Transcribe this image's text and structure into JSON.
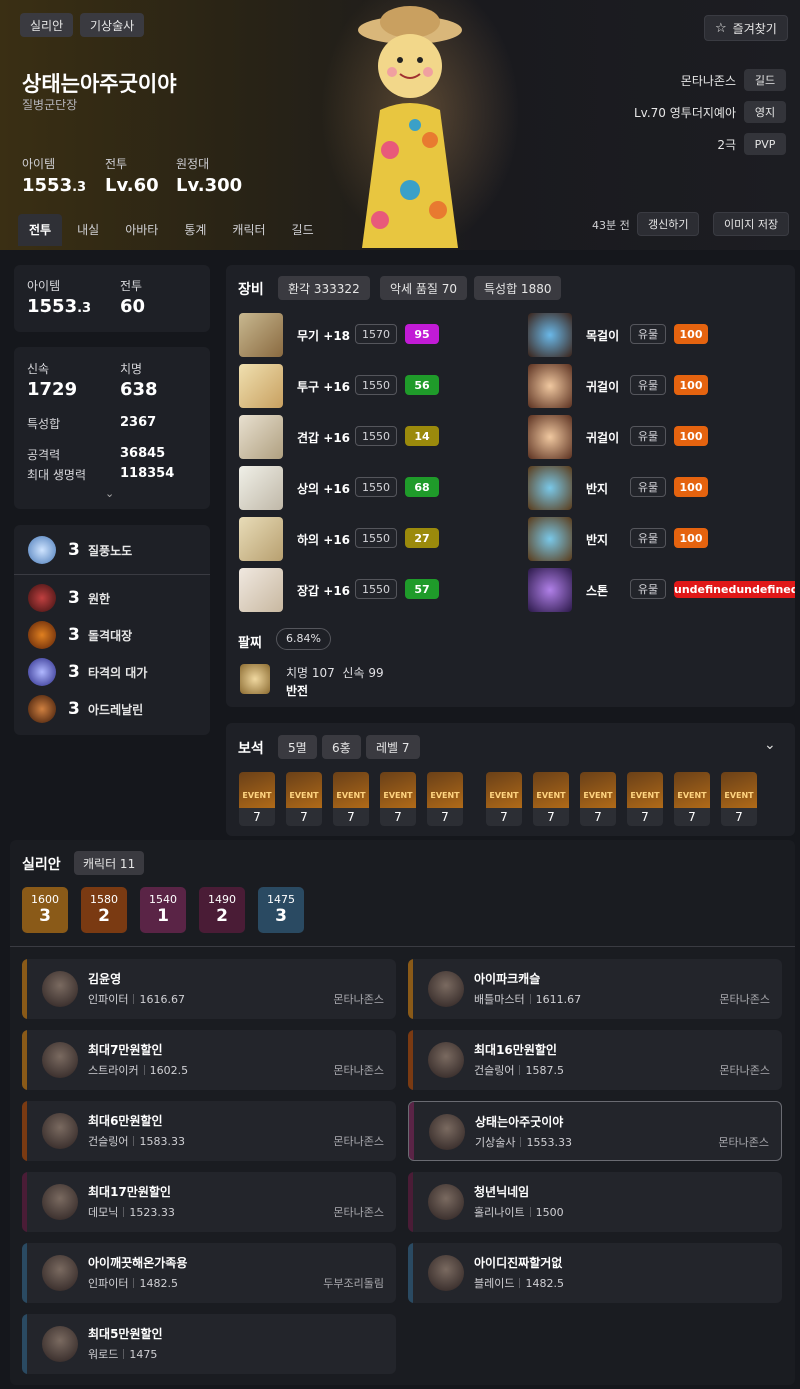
{
  "header": {
    "server_chip": "실리안",
    "class_chip": "기상술사",
    "favorite_label": "즐겨찾기",
    "character_name": "상태는아주굿이야",
    "title": "질병군단장",
    "stats": [
      {
        "label": "아이템",
        "value": "1553",
        "sub": ".3"
      },
      {
        "label": "전투",
        "value": "Lv.60",
        "sub": ""
      },
      {
        "label": "원정대",
        "value": "Lv.300",
        "sub": ""
      }
    ],
    "info_rows": [
      {
        "text": "몬타나존스",
        "badge": "길드"
      },
      {
        "text": "Lv.70 영투더지예아",
        "badge": "영지"
      },
      {
        "text": "2극",
        "badge": "PVP"
      }
    ],
    "tabs": [
      "전투",
      "내실",
      "아바타",
      "통계",
      "캐릭터",
      "길드"
    ],
    "active_tab": "전투",
    "updated": "43분 전",
    "refresh_label": "갱신하기",
    "save_image_label": "이미지 저장"
  },
  "summary": {
    "item_label": "아이템",
    "item_value": "1553",
    "item_sub": ".3",
    "combat_label": "전투",
    "combat_value": "60"
  },
  "combat_stats": {
    "swift_label": "신속",
    "swift_value": "1729",
    "crit_label": "치명",
    "crit_value": "638",
    "trait_label": "특성합",
    "trait_value": "2367",
    "atk_label": "공격력",
    "atk_value": "36845",
    "hp_label": "최대 생명력",
    "hp_value": "118354"
  },
  "engravings": {
    "class": {
      "level": "3",
      "name": "질풍노도",
      "color": "#7fa8d8"
    },
    "list": [
      {
        "level": "3",
        "name": "원한",
        "color": "#8a2a2a"
      },
      {
        "level": "3",
        "name": "돌격대장",
        "color": "#a04a1a"
      },
      {
        "level": "3",
        "name": "타격의 대가",
        "color": "#4a5ad0"
      },
      {
        "level": "3",
        "name": "아드레날린",
        "color": "#8a4a20"
      }
    ]
  },
  "equipment": {
    "title": "장비",
    "chips": [
      "환각 333322",
      "악세 품질 70",
      "특성합 1880"
    ],
    "armor": [
      {
        "name": "무기 +18",
        "level": "1570",
        "quality": "95",
        "qcolor": "#c21bd6",
        "icon": "weapon-icon"
      },
      {
        "name": "투구 +16",
        "level": "1550",
        "quality": "56",
        "qcolor": "#1f9b2a",
        "icon": "helmet-icon"
      },
      {
        "name": "견갑 +16",
        "level": "1550",
        "quality": "14",
        "qcolor": "#9b8a0c",
        "icon": "shoulder-icon"
      },
      {
        "name": "상의 +16",
        "level": "1550",
        "quality": "68",
        "qcolor": "#1f9b2a",
        "icon": "chest-icon"
      },
      {
        "name": "하의 +16",
        "level": "1550",
        "quality": "27",
        "qcolor": "#9b8a0c",
        "icon": "pants-icon"
      },
      {
        "name": "장갑 +16",
        "level": "1550",
        "quality": "57",
        "qcolor": "#1f9b2a",
        "icon": "gloves-icon"
      }
    ],
    "accessories": [
      {
        "name": "목걸이",
        "grade": "유물",
        "quality": "100",
        "icon": "necklace-icon"
      },
      {
        "name": "귀걸이",
        "grade": "유물",
        "quality": "100",
        "icon": "earring-icon"
      },
      {
        "name": "귀걸이",
        "grade": "유물",
        "quality": "100",
        "icon": "earring-icon"
      },
      {
        "name": "반지",
        "grade": "유물",
        "quality": "100",
        "icon": "ring-icon"
      },
      {
        "name": "반지",
        "grade": "유물",
        "quality": "100",
        "icon": "ring-icon"
      },
      {
        "name": "스톤",
        "grade": "유물",
        "quality": "undefinedundefinedu",
        "icon": "stone-icon"
      }
    ],
    "quality_max_color": "#e5630f",
    "bracelet_label": "팔찌",
    "bracelet_percent": "6.84%",
    "bracelet_stats": "치명 107  신속 99",
    "bracelet_effect": "반전"
  },
  "gems": {
    "title": "보석",
    "chips": [
      "5멸",
      "6홍",
      "레벨 7"
    ],
    "event_text": "EVENT",
    "levels": [
      "7",
      "7",
      "7",
      "7",
      "7",
      "7",
      "7",
      "7",
      "7",
      "7",
      "7"
    ]
  },
  "roster": {
    "server": "실리안",
    "count_chip": "캐릭터 11",
    "tiers": [
      {
        "level": "1600",
        "count": "3",
        "color": "#8a5a18"
      },
      {
        "level": "1580",
        "count": "2",
        "color": "#7a3a12"
      },
      {
        "level": "1540",
        "count": "1",
        "color": "#5a2446"
      },
      {
        "level": "1490",
        "count": "2",
        "color": "#4a1c36"
      },
      {
        "level": "1475",
        "count": "3",
        "color": "#2a4a62"
      }
    ],
    "characters": [
      {
        "name": "김윤영",
        "class": "인파이터",
        "ilvl": "1616.67",
        "guild": "몬타나존스",
        "bar": "#8a5a18"
      },
      {
        "name": "아이파크캐슬",
        "class": "배틀마스터",
        "ilvl": "1611.67",
        "guild": "몬타나존스",
        "bar": "#8a5a18"
      },
      {
        "name": "최대7만원할인",
        "class": "스트라이커",
        "ilvl": "1602.5",
        "guild": "몬타나존스",
        "bar": "#8a5a18"
      },
      {
        "name": "최대16만원할인",
        "class": "건슬링어",
        "ilvl": "1587.5",
        "guild": "몬타나존스",
        "bar": "#7a3a12"
      },
      {
        "name": "최대6만원할인",
        "class": "건슬링어",
        "ilvl": "1583.33",
        "guild": "몬타나존스",
        "bar": "#7a3a12"
      },
      {
        "name": "상태는아주굿이야",
        "class": "기상술사",
        "ilvl": "1553.33",
        "guild": "몬타나존스",
        "bar": "#5a2446"
      },
      {
        "name": "최대17만원할인",
        "class": "데모닉",
        "ilvl": "1523.33",
        "guild": "몬타나존스",
        "bar": "#4a1c36"
      },
      {
        "name": "청년닉네임",
        "class": "홀리나이트",
        "ilvl": "1500",
        "guild": "",
        "bar": "#4a1c36"
      },
      {
        "name": "아이깨끗해온가족용",
        "class": "인파이터",
        "ilvl": "1482.5",
        "guild": "두부조리돌림",
        "bar": "#2a4a62"
      },
      {
        "name": "아이디진짜할거없",
        "class": "블레이드",
        "ilvl": "1482.5",
        "guild": "",
        "bar": "#2a4a62"
      },
      {
        "name": "최대5만원할인",
        "class": "워로드",
        "ilvl": "1475",
        "guild": "",
        "bar": "#2a4a62"
      }
    ]
  }
}
